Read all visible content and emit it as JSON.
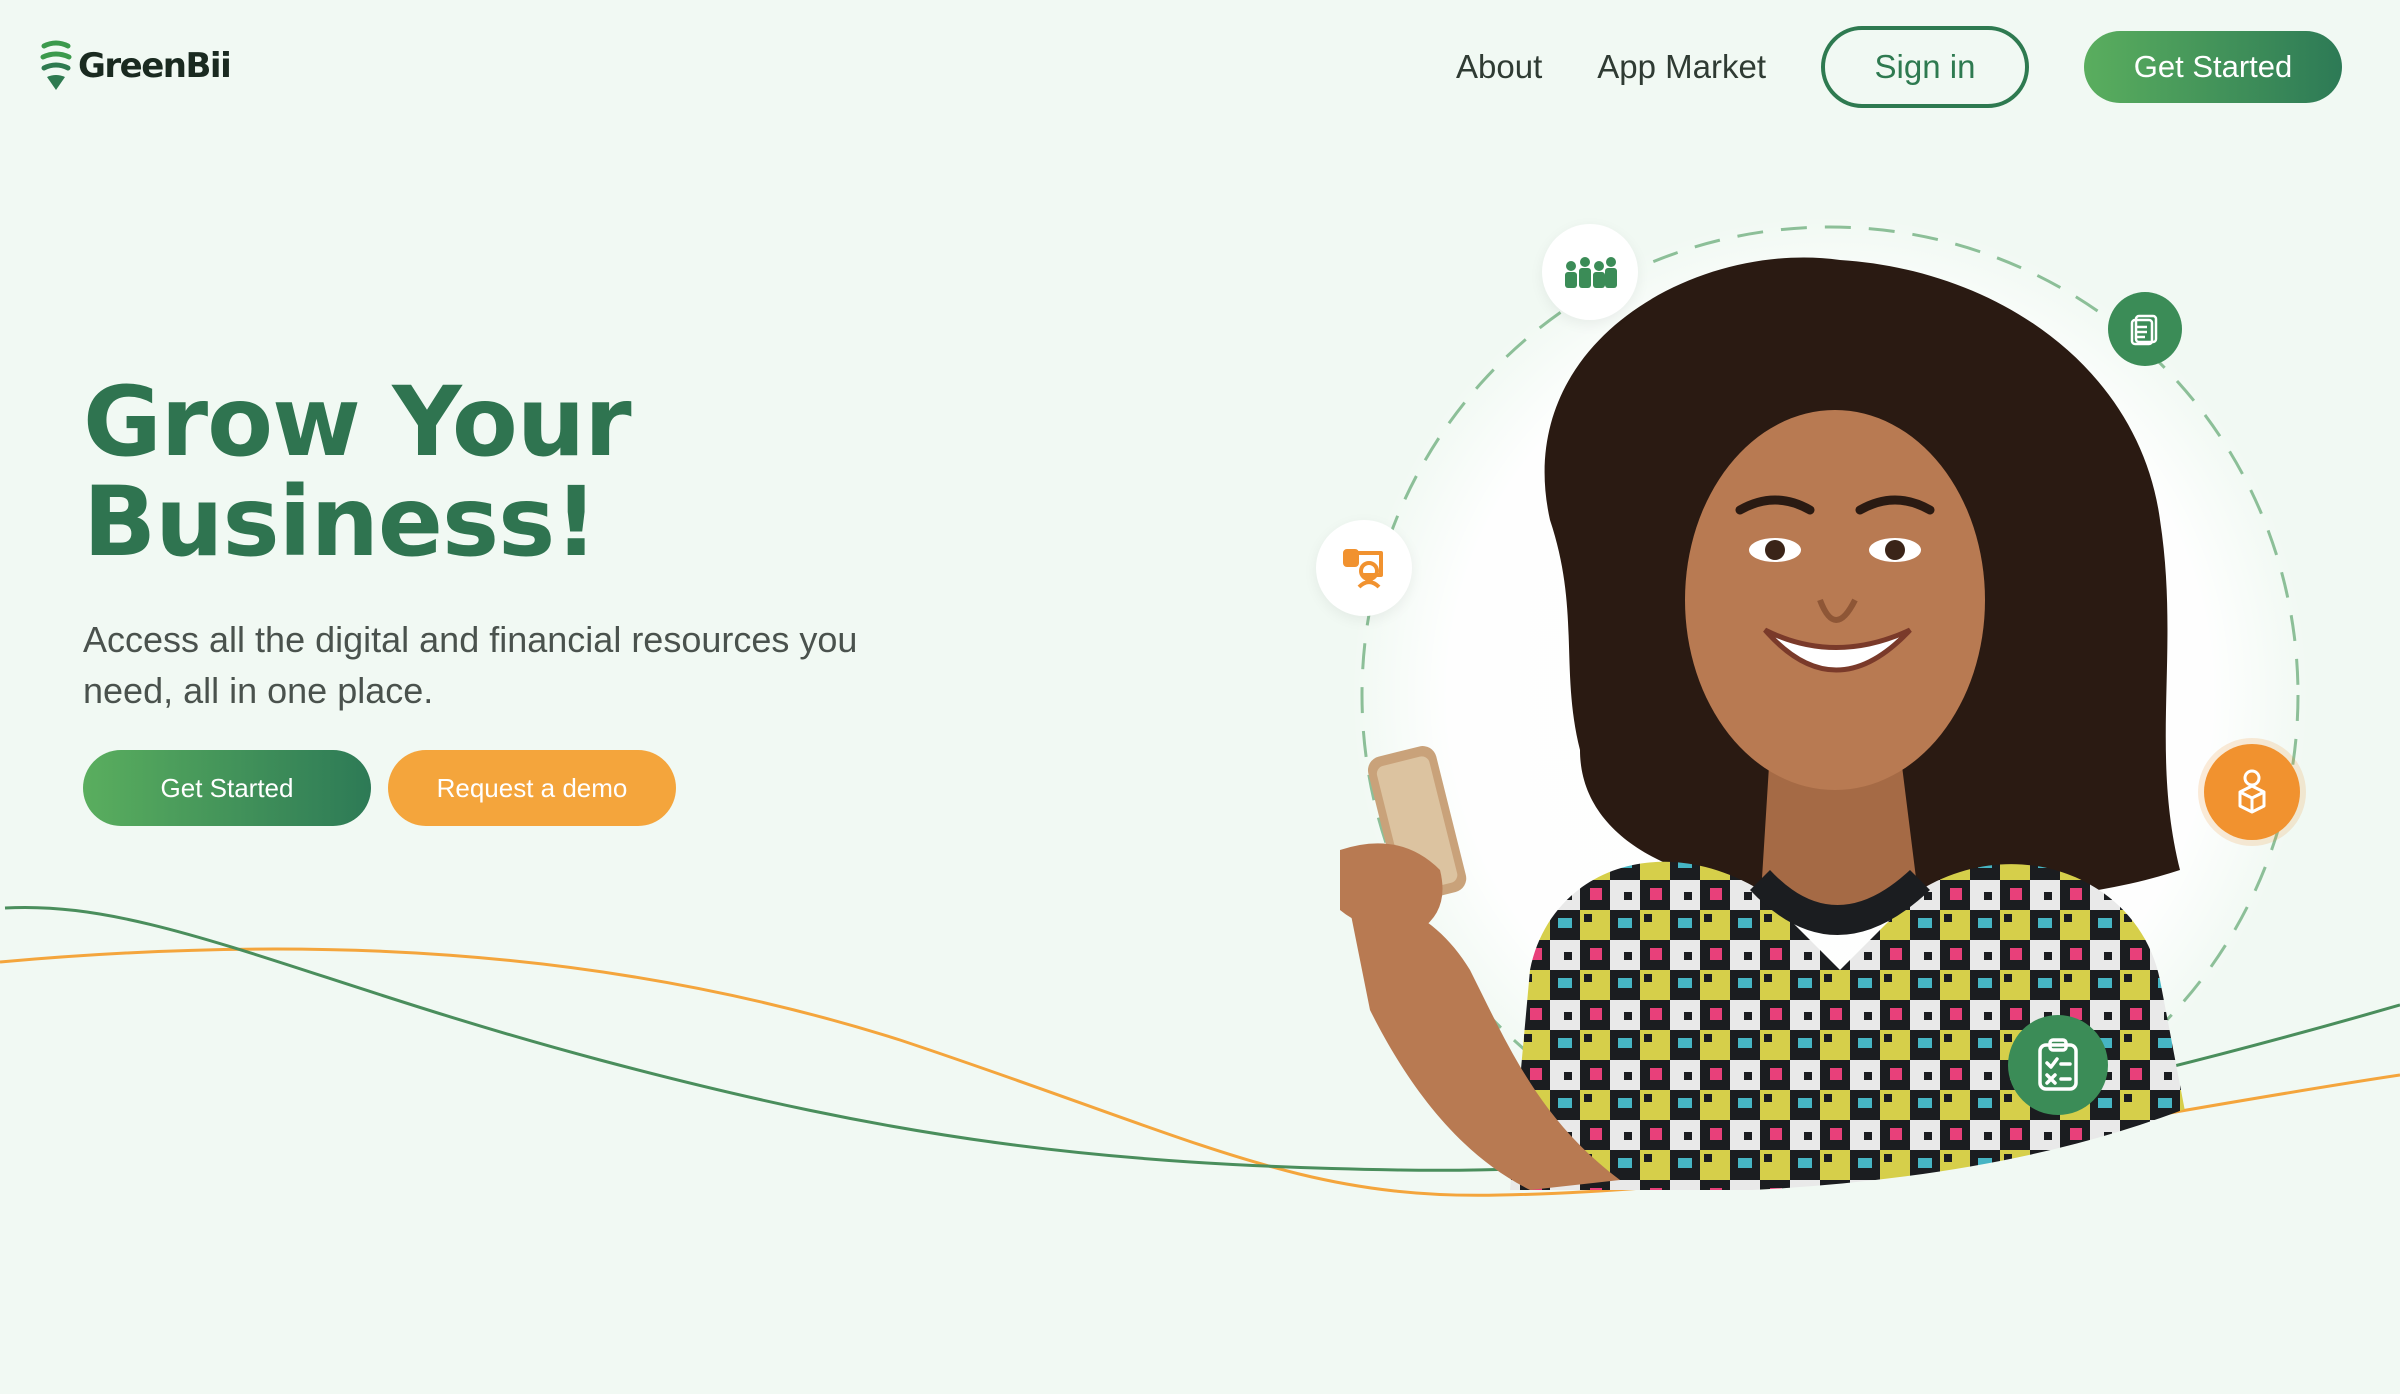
{
  "brand": {
    "name": "GreenBii",
    "primary_color": "#2f7450",
    "accent_color": "#f4a53c"
  },
  "nav": {
    "links": [
      "About",
      "App Market"
    ],
    "sign_in_label": "Sign in",
    "get_started_label": "Get Started"
  },
  "hero": {
    "title_line1": "Grow Your",
    "title_line2": "Business!",
    "subtitle": "Access all the digital and financial resources you need, all in one place.",
    "primary_cta": "Get Started",
    "secondary_cta": "Request a demo"
  },
  "hero_image": {
    "subject": "smiling woman holding a smartphone",
    "orbit_icons": [
      "team-icon",
      "documents-icon",
      "presentation-icon",
      "package-handshake-icon",
      "checklist-icon"
    ]
  }
}
